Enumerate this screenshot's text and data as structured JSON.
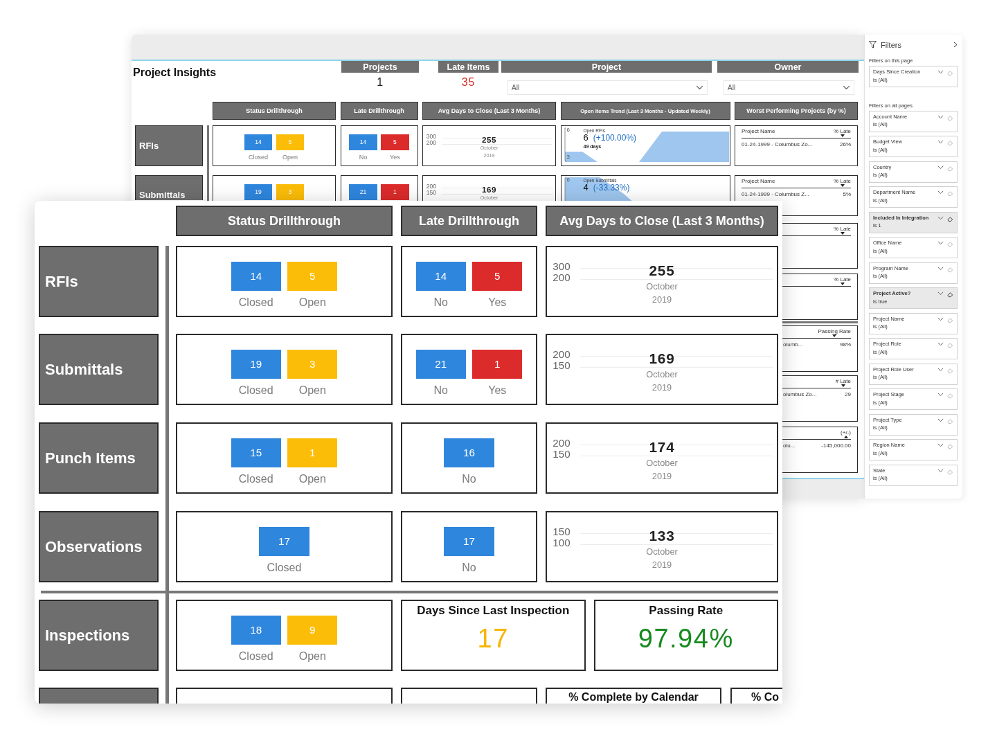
{
  "back_window": {
    "title": "Project Insights",
    "kpis": [
      {
        "label": "Projects",
        "value": "1",
        "color": "#222222"
      },
      {
        "label": "Late Items",
        "value": "35",
        "color": "#d82b2b"
      }
    ],
    "slicers": [
      {
        "label": "Project",
        "value": "All"
      },
      {
        "label": "Owner",
        "value": "All"
      }
    ],
    "column_headers": [
      "Status Drillthrough",
      "Late Drillthrough",
      "Avg Days to Close (Last 3 Months)",
      "Open Items Trend (Last 3 Months - Updated Weekly)",
      "Worst Performing Projects (by %)"
    ],
    "rows": [
      {
        "label": "RFIs",
        "status": [
          {
            "value": "14",
            "label": "Closed",
            "color": "#2f86dd"
          },
          {
            "value": "5",
            "label": "Open",
            "color": "#fbbd08"
          }
        ],
        "late": [
          {
            "value": "14",
            "label": "No",
            "color": "#2f86dd"
          },
          {
            "value": "5",
            "label": "Yes",
            "color": "#dc2b2b"
          }
        ],
        "avg": {
          "axis": [
            "300",
            "200"
          ],
          "value": "255",
          "month": "October",
          "year": "2019"
        },
        "trend": {
          "axis": [
            "6",
            "3"
          ],
          "title": "Open RFIs",
          "value": "6",
          "change": "(+100.00%)",
          "note": "49 days"
        },
        "worst": {
          "columns": [
            "Project Name",
            "% Late"
          ],
          "sorted_descending": true,
          "rows": [
            {
              "name": "01-24-1999 - Columbus Zo...",
              "value": "26%"
            }
          ]
        }
      },
      {
        "label": "Submittals",
        "status": [
          {
            "value": "19",
            "color": "#2f86dd"
          },
          {
            "value": "3",
            "color": "#fbbd08"
          }
        ],
        "late": [
          {
            "value": "21",
            "color": "#2f86dd"
          },
          {
            "value": "1",
            "color": "#dc2b2b"
          }
        ],
        "avg": {
          "axis": [
            "200",
            "150"
          ],
          "value": "169",
          "month": "October"
        },
        "trend": {
          "axis": [
            "6"
          ],
          "title": "Open Submittals",
          "value": "4",
          "change": "(-33.33%)"
        },
        "worst": {
          "columns": [
            "Project Name",
            "% Late"
          ],
          "sorted_descending": true,
          "rows": [
            {
              "name": "01-24-1999 - Columbus Z...",
              "value": "5%"
            }
          ]
        }
      }
    ],
    "right_tables": [
      {
        "column": "% Late",
        "sorted_descending": true
      },
      {
        "column": "% Late",
        "sorted_descending": true
      },
      {
        "column": "Passing Rate",
        "sorted_descending": true,
        "name": "olumb...",
        "value": "98%"
      },
      {
        "column": "# Late",
        "sorted_descending": true,
        "name": "olumbus Zo...",
        "value": "29"
      },
      {
        "column": "(+/-)",
        "sorted_descending": false,
        "name": "olu...",
        "value": "-145,000.00"
      }
    ]
  },
  "filters": {
    "title": "Filters",
    "sections": [
      {
        "title": "Filters on this page",
        "cards": [
          {
            "name": "Days Since Creation",
            "value": "is (All)",
            "applied": false
          }
        ]
      },
      {
        "title": "Filters on all pages",
        "cards": [
          {
            "name": "Account Name",
            "value": "is (All)",
            "applied": false
          },
          {
            "name": "Budget View",
            "value": "is (All)",
            "applied": false
          },
          {
            "name": "Country",
            "value": "is (All)",
            "applied": false
          },
          {
            "name": "Department Name",
            "value": "is (All)",
            "applied": false
          },
          {
            "name": "Included In Integration",
            "value": "is 1",
            "applied": true
          },
          {
            "name": "Office Name",
            "value": "is (All)",
            "applied": false
          },
          {
            "name": "Program Name",
            "value": "is (All)",
            "applied": false
          },
          {
            "name": "Project Active?",
            "value": "is true",
            "applied": true
          },
          {
            "name": "Project Name",
            "value": "is (All)",
            "applied": false
          },
          {
            "name": "Project Role",
            "value": "is (All)",
            "applied": false
          },
          {
            "name": "Project Role User",
            "value": "is (All)",
            "applied": false
          },
          {
            "name": "Project Stage",
            "value": "is (All)",
            "applied": false
          },
          {
            "name": "Project Type",
            "value": "is (All)",
            "applied": false
          },
          {
            "name": "Region Name",
            "value": "is (All)",
            "applied": false
          },
          {
            "name": "State",
            "value": "is (All)",
            "applied": false
          }
        ]
      }
    ]
  },
  "front_window": {
    "column_headers": [
      "Status Drillthrough",
      "Late Drillthrough",
      "Avg Days to Close (Last 3 Months)"
    ],
    "rows": [
      {
        "label": "RFIs",
        "status": [
          {
            "value": "14",
            "label": "Closed",
            "color": "#2f86dd"
          },
          {
            "value": "5",
            "label": "Open",
            "color": "#fbbd08"
          }
        ],
        "late": [
          {
            "value": "14",
            "label": "No",
            "color": "#2f86dd"
          },
          {
            "value": "5",
            "label": "Yes",
            "color": "#dc2b2b"
          }
        ],
        "avg": {
          "axis": [
            "300",
            "200"
          ],
          "value": "255",
          "month": "October",
          "year": "2019"
        }
      },
      {
        "label": "Submittals",
        "status": [
          {
            "value": "19",
            "label": "Closed",
            "color": "#2f86dd"
          },
          {
            "value": "3",
            "label": "Open",
            "color": "#fbbd08"
          }
        ],
        "late": [
          {
            "value": "21",
            "label": "No",
            "color": "#2f86dd"
          },
          {
            "value": "1",
            "label": "Yes",
            "color": "#dc2b2b"
          }
        ],
        "avg": {
          "axis": [
            "200",
            "150"
          ],
          "value": "169",
          "month": "October",
          "year": "2019"
        }
      },
      {
        "label": "Punch Items",
        "status": [
          {
            "value": "15",
            "label": "Closed",
            "color": "#2f86dd"
          },
          {
            "value": "1",
            "label": "Open",
            "color": "#fbbd08"
          }
        ],
        "late": [
          {
            "value": "16",
            "label": "No",
            "color": "#2f86dd"
          }
        ],
        "avg": {
          "axis": [
            "200",
            "150"
          ],
          "value": "174",
          "month": "October",
          "year": "2019"
        }
      },
      {
        "label": "Observations",
        "status": [
          {
            "value": "17",
            "label": "Closed",
            "color": "#2f86dd"
          }
        ],
        "late": [
          {
            "value": "17",
            "label": "No",
            "color": "#2f86dd"
          }
        ],
        "avg": {
          "axis": [
            "150",
            "100"
          ],
          "value": "133",
          "month": "October",
          "year": "2019"
        }
      }
    ],
    "inspections": {
      "label": "Inspections",
      "status": [
        {
          "value": "18",
          "label": "Closed",
          "color": "#2f86dd"
        },
        {
          "value": "9",
          "label": "Open",
          "color": "#fbbd08"
        }
      ],
      "kpis": [
        {
          "title": "Days Since Last Inspection",
          "value": "17",
          "color": "#f7b500"
        },
        {
          "title": "Passing Rate",
          "value": "97.94%",
          "color": "#178a1e"
        }
      ]
    },
    "last_row": {
      "headers": [
        "% Complete by Calendar",
        "% Co"
      ]
    }
  }
}
